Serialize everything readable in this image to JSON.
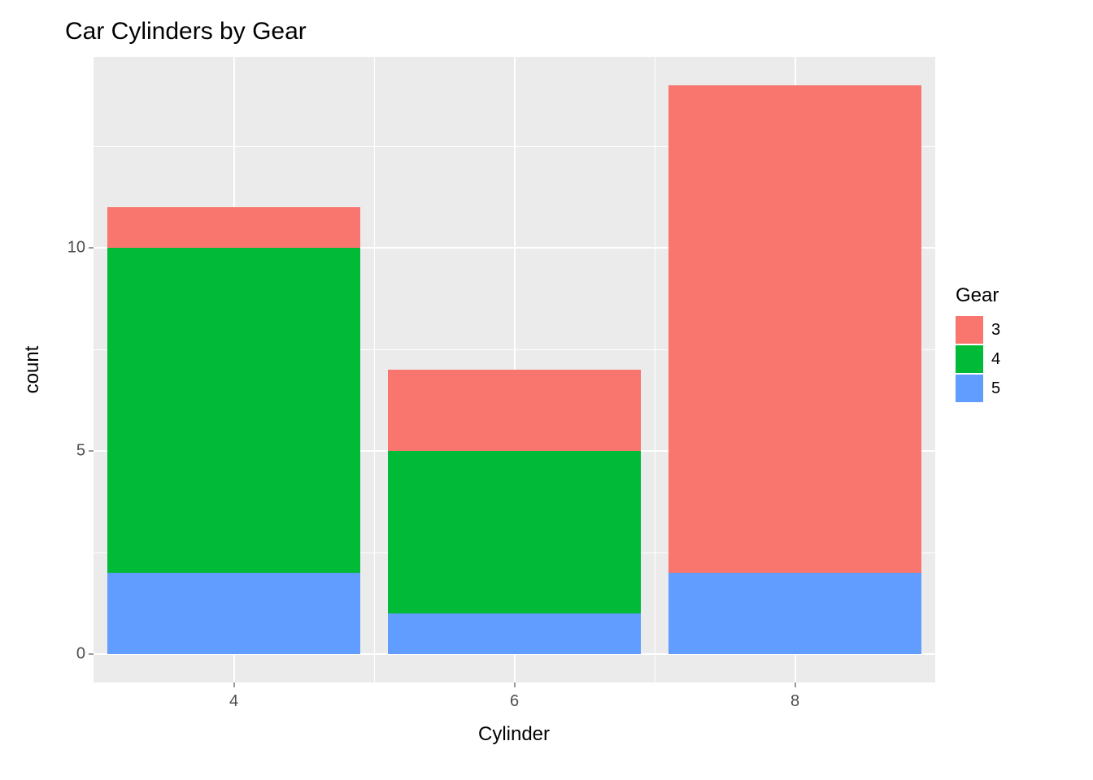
{
  "chart_data": {
    "type": "bar",
    "title": "Car Cylinders by Gear",
    "xlabel": "Cylinder",
    "ylabel": "count",
    "categories": [
      "4",
      "6",
      "8"
    ],
    "series": [
      {
        "name": "3",
        "values": [
          1,
          2,
          12
        ],
        "color": "#F8766D"
      },
      {
        "name": "4",
        "values": [
          8,
          4,
          0
        ],
        "color": "#00BA38"
      },
      {
        "name": "5",
        "values": [
          2,
          1,
          2
        ],
        "color": "#619CFF"
      }
    ],
    "stacked": true,
    "y_ticks": [
      0,
      5,
      10
    ],
    "y_range": [
      -0.7,
      14.7
    ],
    "stack_order_top_to_bottom": [
      "3",
      "4",
      "5"
    ],
    "legend": {
      "title": "Gear",
      "position": "right"
    }
  }
}
